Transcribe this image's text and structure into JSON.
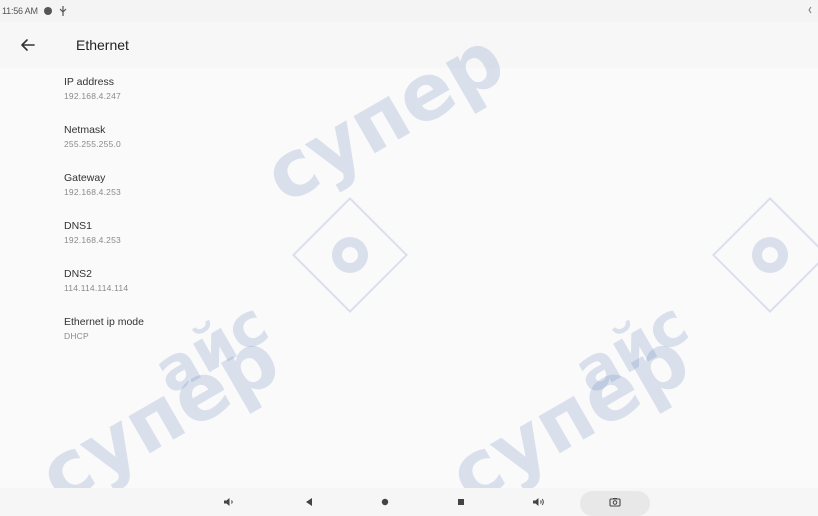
{
  "status_bar": {
    "time": "11:56 AM"
  },
  "app_bar": {
    "title": "Ethernet"
  },
  "settings": [
    {
      "title": "IP address",
      "summary": "192.168.4.247"
    },
    {
      "title": "Netmask",
      "summary": "255.255.255.0"
    },
    {
      "title": "Gateway",
      "summary": "192.168.4.253"
    },
    {
      "title": "DNS1",
      "summary": "192.168.4.253"
    },
    {
      "title": "DNS2",
      "summary": "114.114.114.114"
    },
    {
      "title": "Ethernet ip mode",
      "summary": "DHCP"
    }
  ],
  "nav_bar": {
    "icons": [
      "volume-down-icon",
      "back-icon",
      "home-icon",
      "recents-icon",
      "volume-up-icon",
      "camera-icon"
    ]
  },
  "watermark": {
    "text_1": "супер",
    "text_2": "айс",
    "accent": "#4a6fb0"
  },
  "colors": {
    "background": "#fafafa",
    "title_text": "#333333",
    "summary_text": "#8a8a8a"
  }
}
